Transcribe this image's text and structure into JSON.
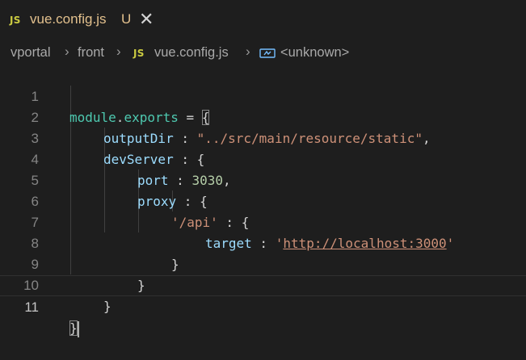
{
  "tab": {
    "badge": "JS",
    "title": "vue.config.js",
    "status": "U",
    "close": "✕"
  },
  "breadcrumb": {
    "items": [
      "vportal",
      "front",
      "vue.config.js",
      "<unknown>"
    ],
    "file_badge": "JS",
    "separator": "›"
  },
  "editor": {
    "active_line": 11,
    "lines": [
      {
        "n": "1"
      },
      {
        "n": "2"
      },
      {
        "n": "3"
      },
      {
        "n": "4"
      },
      {
        "n": "5"
      },
      {
        "n": "6"
      },
      {
        "n": "7"
      },
      {
        "n": "8"
      },
      {
        "n": "9"
      },
      {
        "n": "10"
      },
      {
        "n": "11"
      }
    ],
    "tokens": {
      "module": "module",
      "dot": ".",
      "exports": "exports",
      "assign": " = ",
      "open_brace": "{",
      "close_brace": "}",
      "outputDir": "outputDir",
      "colon": " : ",
      "outputDir_value": "\"../src/main/resource/static\"",
      "comma": ",",
      "devServer": "devServer",
      "port": "port",
      "port_value": "3030",
      "proxy": "proxy",
      "api_key": "'/api'",
      "target": "target",
      "target_quote": "'",
      "target_url": "http://localhost:3000"
    }
  },
  "colors": {
    "background": "#1e1e1e",
    "modified_file": "#e2c08d",
    "js_badge": "#cbcb41",
    "variable": "#4ec9b0",
    "property": "#9cdcfe",
    "string": "#ce9178",
    "number": "#b5cea8"
  }
}
